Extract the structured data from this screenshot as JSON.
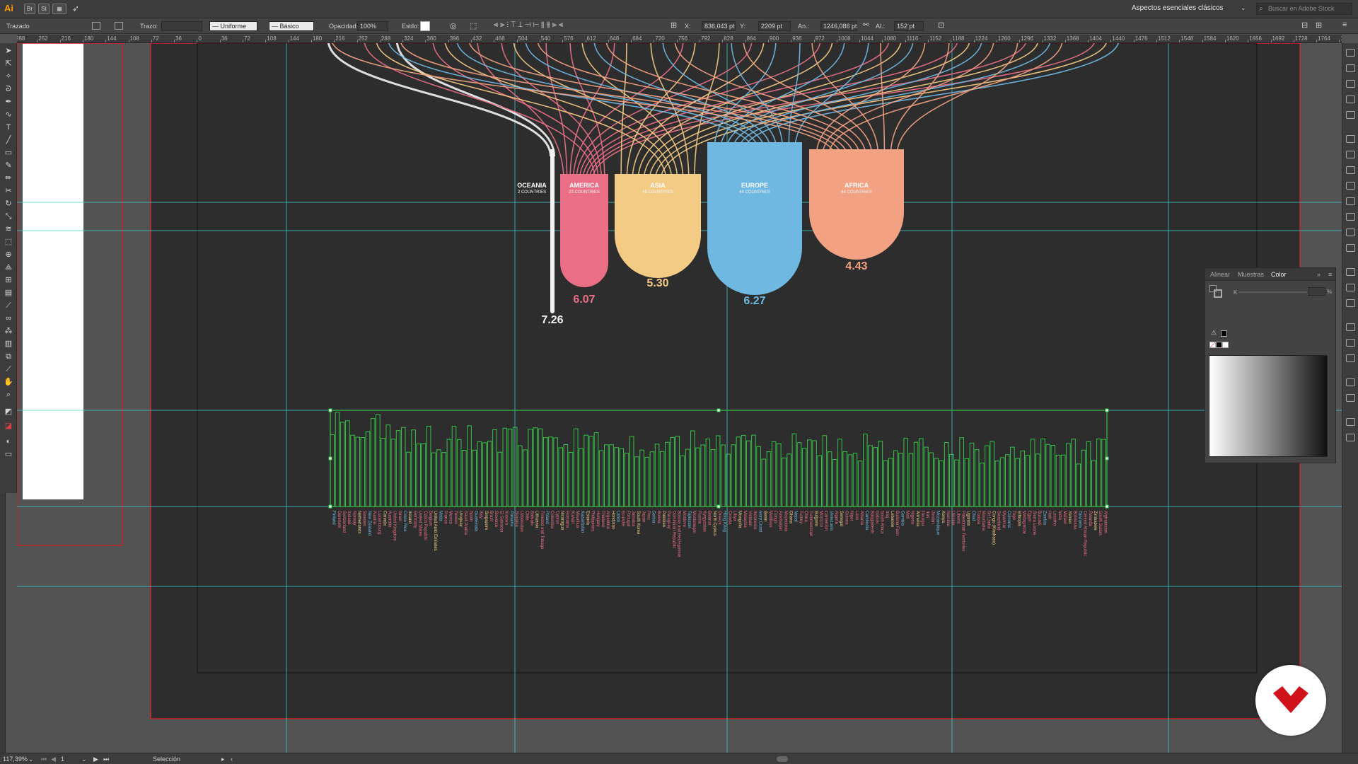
{
  "app": {
    "logo": "Ai",
    "buttons": [
      "Br",
      "St"
    ],
    "workspace": "Aspectos esenciales clásicos",
    "stock_search_placeholder": "Buscar en Adobe Stock"
  },
  "control_bar": {
    "object_type": "Trazado",
    "stroke_label": "Trazo:",
    "stroke_profile": "Uniforme",
    "brush": "Básico",
    "opacity_label": "Opacidad:",
    "opacity": "100%",
    "style_label": "Estilo:",
    "x_label": "X:",
    "x": "836,043 pt",
    "y_label": "Y:",
    "y": "2209 pt",
    "width_label": "An.:",
    "width": "1246,086 pt",
    "height_label": "Al.:",
    "height": "152 pt"
  },
  "ruler_labels": [
    "288",
    "252",
    "216",
    "180",
    "144",
    "108",
    "72",
    "36",
    "0",
    "36",
    "72",
    "108",
    "144",
    "180",
    "216",
    "252",
    "288",
    "324",
    "360",
    "396",
    "432",
    "468",
    "504",
    "540",
    "576",
    "612",
    "648",
    "684",
    "720",
    "756",
    "792",
    "828",
    "864",
    "900",
    "936",
    "972",
    "1008",
    "1044",
    "1080",
    "1116",
    "1152",
    "1188",
    "1224",
    "1260",
    "1296",
    "1332",
    "1368",
    "1404",
    "1440",
    "1476",
    "1512",
    "1548",
    "1584",
    "1620",
    "1656",
    "1692",
    "1728",
    "1764",
    "1800"
  ],
  "color_panel": {
    "tabs": [
      "Alinear",
      "Muestras",
      "Color"
    ],
    "active_tab": "Color",
    "channel_label": "K",
    "percent": "%"
  },
  "artwork": {
    "continents": [
      {
        "name": "OCEANIA",
        "countries": "2 COUNTRIES",
        "value": "7.26",
        "color": "#f2f2f2"
      },
      {
        "name": "AMERICA",
        "countries": "23 COUNTRIES",
        "value": "6.07",
        "color": "#ea6f86"
      },
      {
        "name": "ASIA",
        "countries": "48 COUNTRIES",
        "value": "5.30",
        "color": "#f4cb85"
      },
      {
        "name": "EUROPE",
        "countries": "44 COUNTRIES",
        "value": "6.27",
        "color": "#6fb8e2"
      },
      {
        "name": "AFRICA",
        "countries": "44 COUNTRIES",
        "value": "4.43",
        "color": "#f2a283"
      }
    ],
    "bar_color": "#37c24b",
    "guide_color": "#3fd0d0",
    "country_labels": [
      "Finland",
      "Denmark",
      "Switzerland",
      "Iceland",
      "Norway",
      "Netherlands",
      "Sweden",
      "New Zealand",
      "Austria",
      "Luxembourg",
      "Canada",
      "Australia",
      "United Kingdom",
      "Israel",
      "Costa Rica",
      "Ireland",
      "Germany",
      "United States",
      "Czech Republic",
      "Belgium",
      "United Arab Emirates",
      "Malta",
      "France",
      "Mexico",
      "Taiwan",
      "Uruguay",
      "Saudi Arabia",
      "Spain",
      "Guatemala",
      "Italy",
      "Singapore",
      "Brazil",
      "Slovenia",
      "El Salvador",
      "Kosovo",
      "Panama",
      "Slovakia",
      "Uzbekistan",
      "Chile",
      "Bahrain",
      "Lithuania",
      "Trinidad and Tobago",
      "Poland",
      "Colombia",
      "Cyprus",
      "Nicaragua",
      "Romania",
      "Kuwait",
      "Mauritius",
      "Kazakhstan",
      "Estonia",
      "Philippines",
      "Hungary",
      "Thailand",
      "Argentina",
      "Honduras",
      "Latvia",
      "Ecuador",
      "Portugal",
      "Jamaica",
      "South Korea",
      "Japan",
      "Peru",
      "Serbia",
      "Bolivia",
      "Pakistan",
      "Paraguay",
      "Dominican Republic",
      "Bosnia and Herzegovina",
      "Moldova",
      "Tajikistan",
      "Montenegro",
      "Russia",
      "Kyrgyzstan",
      "Belarus",
      "North Cyprus",
      "Greece",
      "Hong Kong",
      "Croatia",
      "Libya",
      "Mongolia",
      "Malaysia",
      "Vietnam",
      "Indonesia",
      "Ivory Coast",
      "Benin",
      "Maldives",
      "Congo",
      "Azerbaijan",
      "Macedonia",
      "Ghana",
      "Nepal",
      "Turkey",
      "China",
      "Turkmenistan",
      "Bulgaria",
      "Morocco",
      "Cameroon",
      "Venezuela",
      "Algeria",
      "Senegal",
      "Guinea",
      "Niger",
      "Laos",
      "Albania",
      "Cambodia",
      "Bangladesh",
      "Gabon",
      "South Africa",
      "Iraq",
      "Lebanon",
      "Burkina Faso",
      "Gambia",
      "Mali",
      "Nigeria",
      "Armenia",
      "Georgia",
      "Iran",
      "Jordan",
      "Mozambique",
      "Kenya",
      "Namibia",
      "Ukraine",
      "Liberia",
      "Palestinian Territories",
      "Uganda",
      "Chad",
      "Tunisia",
      "Mauritania",
      "Sri Lanka",
      "Congo (Kinshasa)",
      "Swaziland",
      "Myanmar",
      "Comoros",
      "Togo",
      "Ethiopia",
      "Madagascar",
      "Egypt",
      "Sierra Leone",
      "Burundi",
      "Zambia",
      "Haiti",
      "Lesotho",
      "India",
      "Malawi",
      "Yemen",
      "Botswana",
      "Tanzania",
      "Central African Republic",
      "Rwanda",
      "Zimbabwe",
      "South Sudan",
      "Afghanistan"
    ]
  },
  "status": {
    "zoom": "117,39%",
    "artboard": "1",
    "tool": "Selección"
  }
}
